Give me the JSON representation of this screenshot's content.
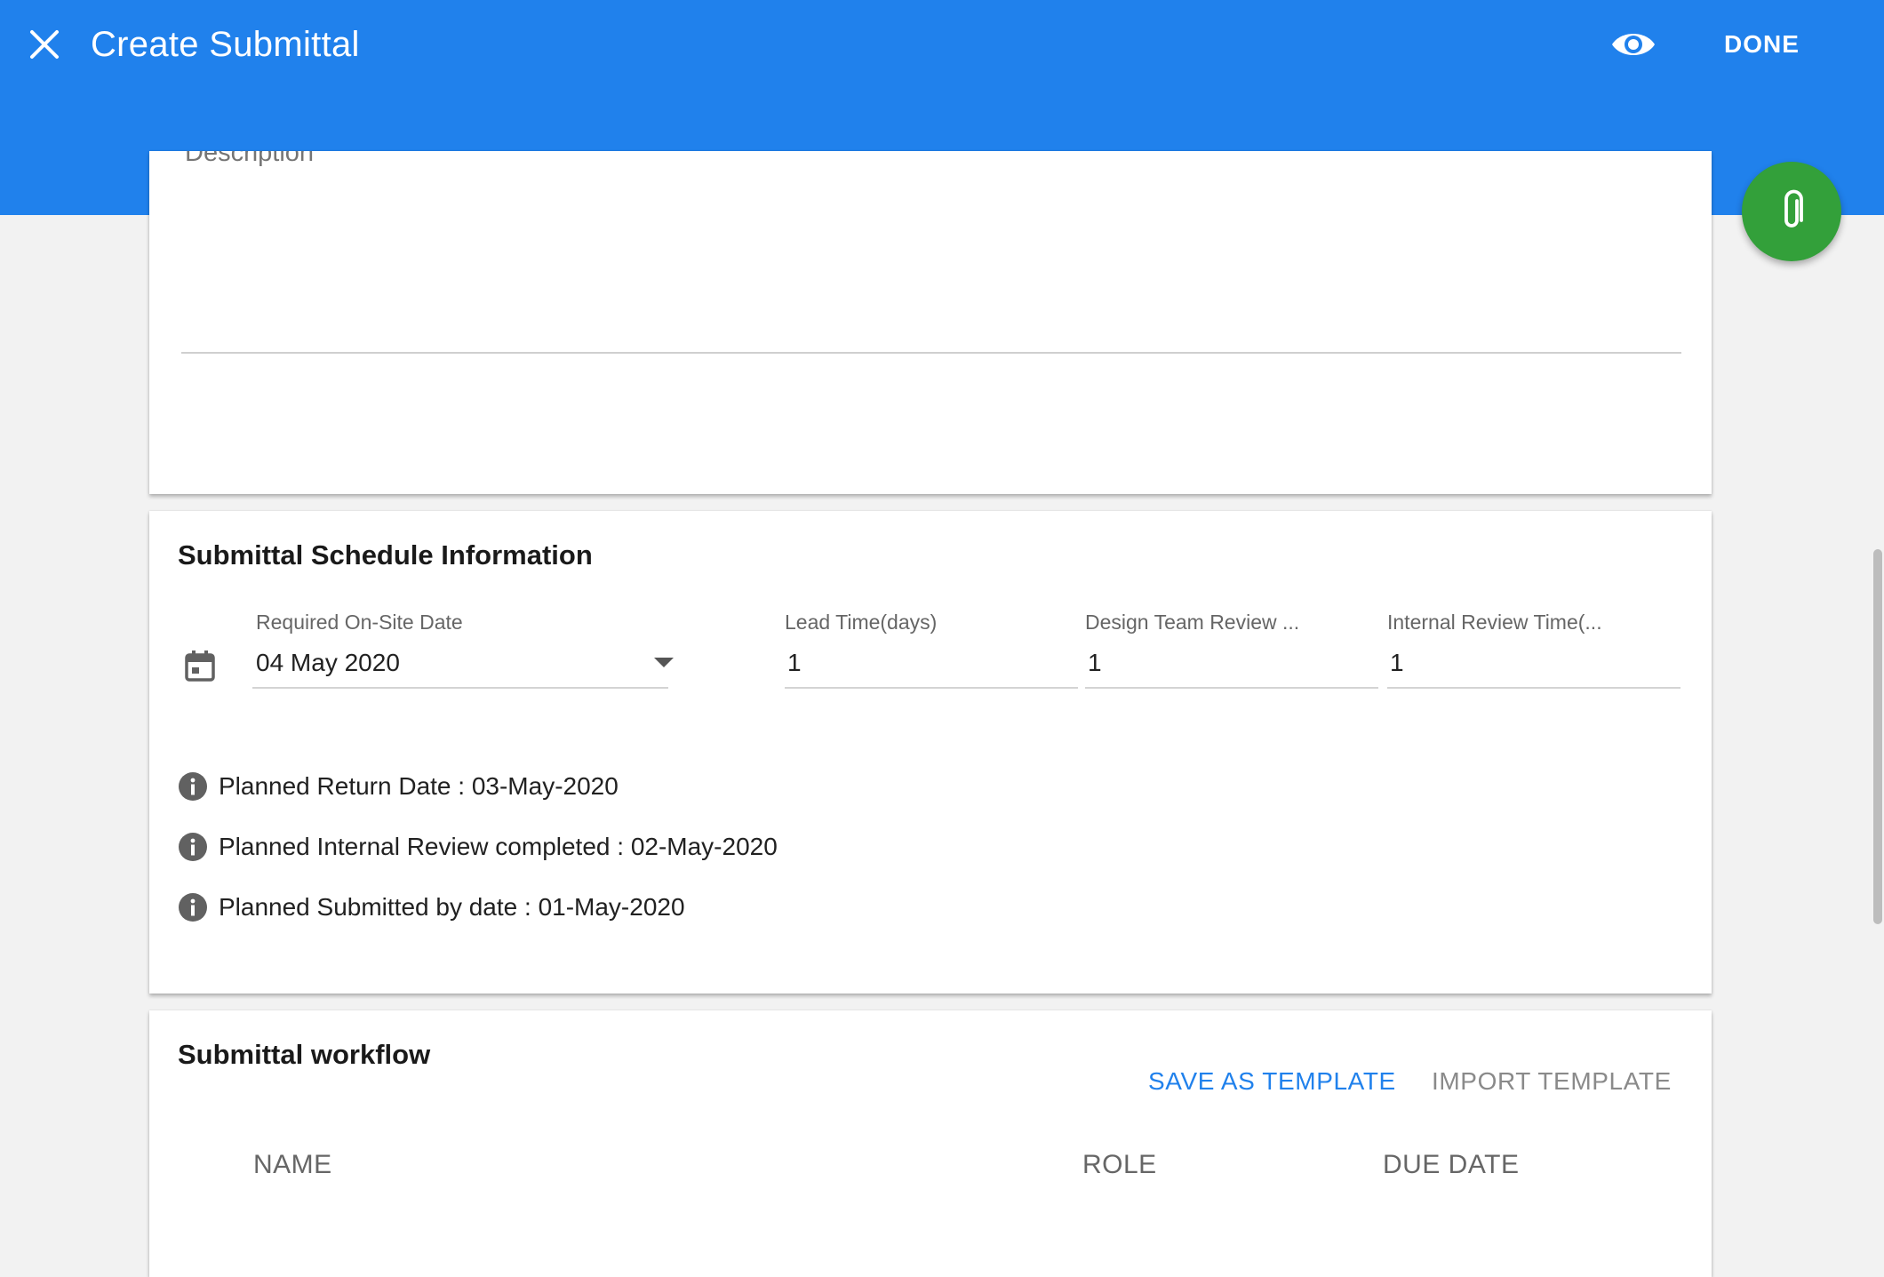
{
  "appbar": {
    "title": "Create Submittal",
    "done_label": "DONE",
    "close_icon": "close-icon",
    "preview_icon": "eye-icon"
  },
  "description_card": {
    "label": "Description"
  },
  "schedule": {
    "title": "Submittal Schedule Information",
    "required_onsite_date": {
      "label": "Required On-Site Date",
      "value": "04 May 2020"
    },
    "lead_time": {
      "label": "Lead Time(days)",
      "value": "1"
    },
    "design_team_review": {
      "label": "Design Team Review ...",
      "value": "1"
    },
    "internal_review_time": {
      "label": "Internal Review Time(...",
      "value": "1"
    },
    "info": [
      "Planned Return Date : 03-May-2020",
      "Planned Internal Review completed : 02-May-2020",
      "Planned Submitted by date : 01-May-2020"
    ]
  },
  "workflow": {
    "title": "Submittal workflow",
    "save_template_label": "SAVE AS TEMPLATE",
    "import_template_label": "IMPORT TEMPLATE",
    "columns": [
      "NAME",
      "ROLE",
      "DUE DATE"
    ]
  },
  "fab": {
    "icon": "attachment-icon"
  },
  "colors": {
    "appbar": "#2081ec",
    "accent_link": "#2081ec",
    "fab": "#33a03a",
    "disabled_text": "#8a8a8a"
  }
}
